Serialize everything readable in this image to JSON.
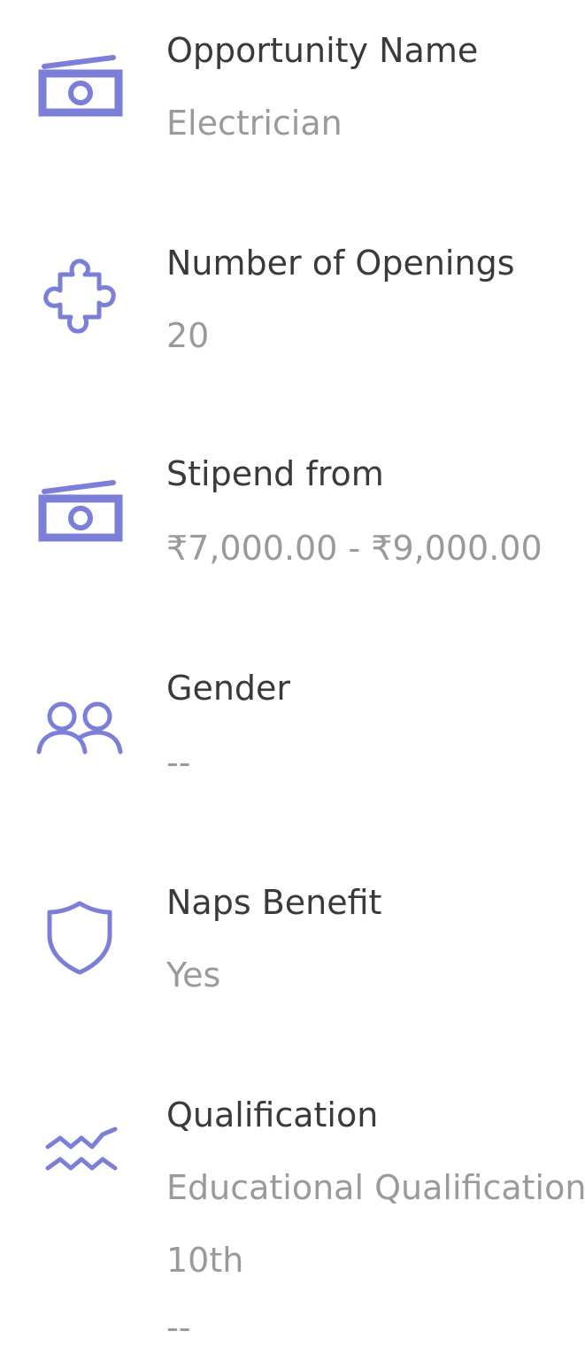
{
  "accent_color": "#7b7fd8",
  "details": [
    {
      "icon": "money-icon",
      "label": "Opportunity Name",
      "value": "Electrician"
    },
    {
      "icon": "puzzle-icon",
      "label": "Number of Openings",
      "value": "20"
    },
    {
      "icon": "money-icon",
      "label": "Stipend from",
      "value": "₹7,000.00 - ₹9,000.00"
    },
    {
      "icon": "users-icon",
      "label": "Gender",
      "value": "--"
    },
    {
      "icon": "shield-icon",
      "label": "Naps Benefit",
      "value": "Yes"
    },
    {
      "icon": "waves-icon",
      "label": "Qualification",
      "values": [
        "Educational Qualification,",
        "10th",
        "--"
      ]
    }
  ]
}
